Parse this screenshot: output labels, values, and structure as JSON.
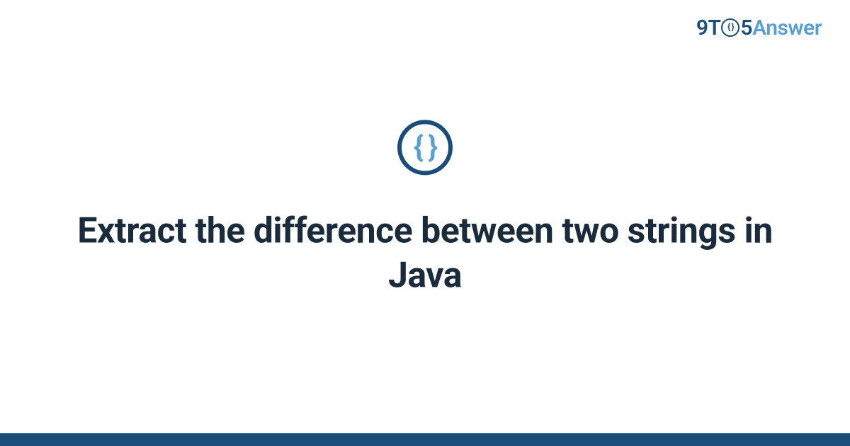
{
  "logo": {
    "part1": "9T",
    "circle_inner": "{ }",
    "part2": "5",
    "part3": "Answer"
  },
  "icon": {
    "braces": "{ }"
  },
  "title": "Extract the difference between two strings in Java"
}
